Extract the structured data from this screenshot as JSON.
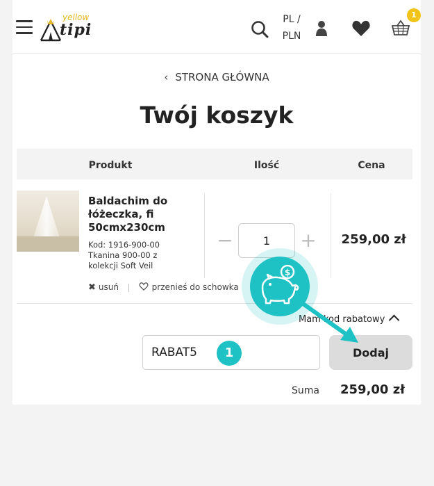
{
  "header": {
    "logo_top": "yellow",
    "logo_main": "tipi",
    "language": "PL /",
    "currency": "PLN",
    "cart_count": "1",
    "icons": [
      "menu-icon",
      "search-icon",
      "user-icon",
      "heart-icon",
      "basket-icon"
    ]
  },
  "breadcrumb": {
    "back_label": "STRONA GŁÓWNA"
  },
  "page_title": "Twój koszyk",
  "table": {
    "col_product": "Produkt",
    "col_qty": "Ilość",
    "col_price": "Cena"
  },
  "item": {
    "name": "Baldachim do łóżeczka, fi 50cmx230cm",
    "code_line1": "Kod: 1916-900-00",
    "code_line2": "Tkanina 900-00 z",
    "code_line3": "kolekcji Soft Veil",
    "remove_label": "usuń",
    "save_label": "przenieś do schowka",
    "quantity": "1",
    "price": "259,00 zł"
  },
  "coupon": {
    "toggle_label": "Mam kod rabatowy",
    "code_value": "RABAT5",
    "add_button": "Dodaj"
  },
  "summary": {
    "sum_label": "Suma",
    "sum_value": "259,00 zł"
  },
  "overlay": {
    "step_number": "1",
    "accent_color": "#1ec2c4",
    "coin_symbol": "$"
  },
  "colors": {
    "badge": "#f2c318",
    "logo_yellow": "#e7b923"
  }
}
